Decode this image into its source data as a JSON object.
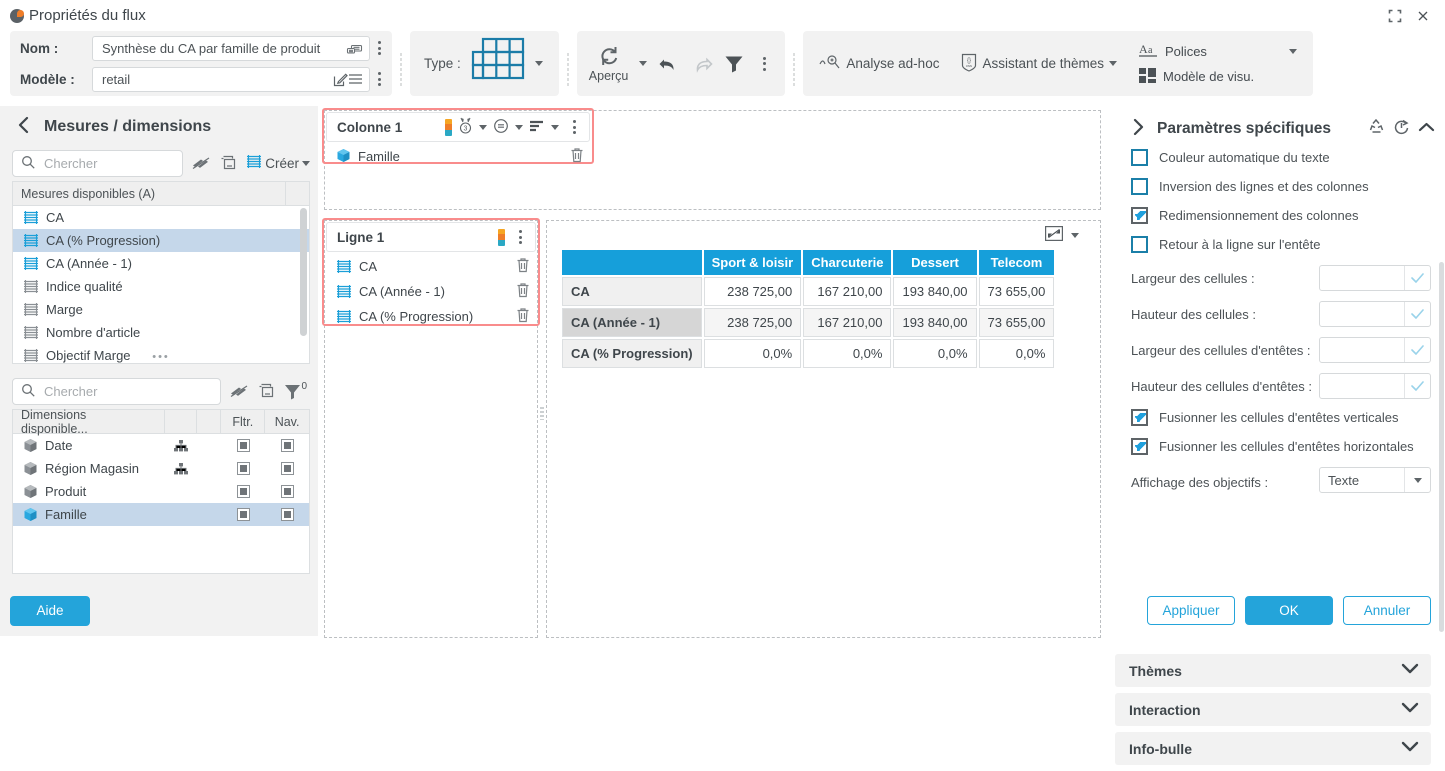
{
  "window": {
    "title": "Propriétés du flux",
    "restore_icon": "restore-icon",
    "close_icon": "close-icon"
  },
  "ribbon": {
    "name_label": "Nom :",
    "name_value": "Synthèse du CA par famille de produit",
    "model_label": "Modèle :",
    "model_value": "retail",
    "type_label": "Type :",
    "preview_label": "Aperçu",
    "adhoc_label": "Analyse ad-hoc",
    "theme_assistant_label": "Assistant de thèmes",
    "fonts_label": "Polices",
    "visual_model_label": "Modèle de visu."
  },
  "left_panel": {
    "title": "Mesures / dimensions",
    "back_icon": "chevron-left-icon",
    "measures": {
      "search_placeholder": "Chercher",
      "create_label": "Créer",
      "header": "Mesures disponibles (A)",
      "items": [
        {
          "label": "CA",
          "active": true,
          "selected": false
        },
        {
          "label": "CA (% Progression)",
          "active": true,
          "selected": true
        },
        {
          "label": "CA (Année - 1)",
          "active": true,
          "selected": false
        },
        {
          "label": "Indice qualité",
          "active": false,
          "selected": false
        },
        {
          "label": "Marge",
          "active": false,
          "selected": false
        },
        {
          "label": "Nombre d'article",
          "active": false,
          "selected": false
        },
        {
          "label": "Objectif Marge",
          "active": false,
          "selected": false
        }
      ]
    },
    "dimensions": {
      "search_placeholder": "Chercher",
      "filter_count": "0",
      "headers": [
        "Dimensions disponible...",
        "",
        "",
        "Fltr.",
        "Nav."
      ],
      "items": [
        {
          "label": "Date",
          "hierarchy": true,
          "selected": false
        },
        {
          "label": "Région Magasin",
          "hierarchy": true,
          "selected": false
        },
        {
          "label": "Produit",
          "hierarchy": false,
          "selected": false
        },
        {
          "label": "Famille",
          "hierarchy": false,
          "selected": true
        }
      ]
    },
    "help_button": "Aide"
  },
  "center": {
    "column_zone": {
      "title": "Colonne 1",
      "icons": [
        "color-bar-icon",
        "medal-icon",
        "equals-circle-icon",
        "sort-icon",
        "kebab-menu-icon"
      ],
      "items": [
        {
          "label": "Famille",
          "type": "dimension"
        }
      ]
    },
    "row_zone": {
      "title": "Ligne 1",
      "icons": [
        "color-bar-icon",
        "kebab-menu-icon"
      ],
      "items": [
        {
          "label": "CA",
          "type": "measure"
        },
        {
          "label": "CA (Année - 1)",
          "type": "measure"
        },
        {
          "label": "CA (% Progression)",
          "type": "measure"
        }
      ]
    },
    "expand_icon": "expand-icon"
  },
  "chart_data": {
    "type": "table",
    "title": "",
    "corner_header": "",
    "categories": [
      "Sport & loisir",
      "Charcuterie",
      "Dessert",
      "Telecom"
    ],
    "series": [
      {
        "name": "CA",
        "values": [
          "238 725,00",
          "167 210,00",
          "193 840,00",
          "73 655,00"
        ]
      },
      {
        "name": "CA (Année - 1)",
        "values": [
          "238 725,00",
          "167 210,00",
          "193 840,00",
          "73 655,00"
        ]
      },
      {
        "name": "CA (% Progression)",
        "values": [
          "0,0%",
          "0,0%",
          "0,0%",
          "0,0%"
        ]
      }
    ],
    "header_color": "#169fda"
  },
  "right_panel": {
    "title": "Paramètres spécifiques",
    "expand_icon": "chevron-right-icon",
    "head_icons": [
      "recycle-icon",
      "reset-icon",
      "chevron-up-icon"
    ],
    "checkboxes": [
      {
        "label": "Couleur automatique du texte",
        "checked": false
      },
      {
        "label": "Inversion des lignes et des colonnes",
        "checked": false
      },
      {
        "label": "Redimensionnement des colonnes",
        "checked": true
      },
      {
        "label": "Retour à la ligne sur l'entête",
        "checked": false
      }
    ],
    "fields": [
      {
        "label": "Largeur des cellules :",
        "value": ""
      },
      {
        "label": "Hauteur des cellules :",
        "value": ""
      },
      {
        "label": "Largeur des cellules d'entêtes :",
        "value": ""
      },
      {
        "label": "Hauteur des cellules d'entêtes :",
        "value": ""
      }
    ],
    "checkboxes2": [
      {
        "label": "Fusionner les cellules d'entêtes verticales",
        "checked": true
      },
      {
        "label": "Fusionner les cellules d'entêtes horizontales",
        "checked": true
      }
    ],
    "objectives_label": "Affichage des objectifs :",
    "objectives_value": "Texte",
    "accordions": [
      {
        "label": "Thèmes"
      },
      {
        "label": "Interaction"
      },
      {
        "label": "Info-bulle"
      }
    ],
    "buttons": {
      "apply": "Appliquer",
      "ok": "OK",
      "cancel": "Annuler"
    }
  },
  "colors": {
    "accent": "#24a4da",
    "table_header": "#169fda",
    "highlight": "#f98c8c",
    "selection": "#c5d7ea"
  }
}
